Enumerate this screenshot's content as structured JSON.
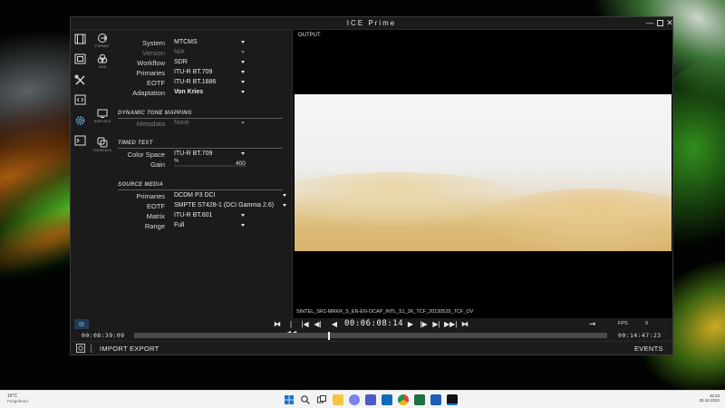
{
  "window": {
    "title": "ICE Prime",
    "minimize_glyph": "—",
    "close_glyph": "✕"
  },
  "sidebar": {
    "rail_icons": [
      "film-icon",
      "film-grid-icon",
      "tools-icon",
      "code-window-icon",
      "gear-icon",
      "terminal-icon"
    ],
    "sub_items": [
      {
        "label": "FORMAT",
        "icon": "format-exit-icon"
      },
      {
        "label": "CMS",
        "icon": "color-circles-icon"
      },
      {
        "label": "DISPLAYS",
        "icon": "display-icon"
      },
      {
        "label": "OVERLAYS",
        "icon": "overlays-icon"
      }
    ]
  },
  "settings": {
    "system": {
      "label": "System",
      "value": "MTCMS"
    },
    "version": {
      "label": "Version",
      "value": "N/A"
    },
    "workflow": {
      "label": "Workflow",
      "value": "SDR"
    },
    "primaries": {
      "label": "Primaries",
      "value": "ITU-R BT.709"
    },
    "eotf": {
      "label": "EOTF",
      "value": "ITU-R BT.1886"
    },
    "adaptation": {
      "label": "Adaptation",
      "value": "Von Kries"
    },
    "dtm_section": "DYNAMIC TONE MAPPING",
    "metadata": {
      "label": "Metadata",
      "value": "None"
    },
    "timed_text_section": "TIMED TEXT",
    "color_space": {
      "label": "Color Space",
      "value": "ITU-R BT.709"
    },
    "gain": {
      "label": "Gain",
      "percent_label": "%",
      "value": "400",
      "level": 0.0
    },
    "source_section": "SOURCE MEDIA",
    "src_primaries": {
      "label": "Primaries",
      "value": "DCDM P3 DCI"
    },
    "src_eotf": {
      "label": "EOTF",
      "value": "SMPTE ST428-1 (DCI Gamma 2.6)"
    },
    "matrix": {
      "label": "Matrix",
      "value": "ITU-R BT.601"
    },
    "range": {
      "label": "Range",
      "value": "Full"
    }
  },
  "viewer": {
    "label": "OUTPUT",
    "filename": "SINTEL_SR1-MRKR_S_EN-EN-OCAP_INTL_51_2K_TCF_20130529_TCF_OV"
  },
  "transport": {
    "timecode": "00:06:08:14",
    "fps_label": "FPS",
    "fps_value": "0",
    "buttons": [
      "⧓",
      "|◀◀",
      "|◀",
      "◀|",
      "◀",
      "▶",
      "|▶",
      "▶|",
      "▶▶|",
      "⧓"
    ],
    "forward_arrow": "➞"
  },
  "timeline": {
    "start": "00:08:39:09",
    "end": "00:14:47:23",
    "position": 0.41
  },
  "bottombar": {
    "import": "IMPORT",
    "export": "EXPORT",
    "events": "EVENTS"
  },
  "taskbar": {
    "temperature": "16°C",
    "condition": "Freigehend",
    "time": "15:23",
    "date": "25.10.2022",
    "icons": [
      "windows-start-icon",
      "search-icon",
      "task-view-icon",
      "file-explorer-icon",
      "chat-icon",
      "teams-icon",
      "outlook-icon",
      "chrome-icon",
      "excel-icon",
      "word-icon",
      "ice-prime-icon"
    ]
  },
  "colors": {
    "window_bg": "#1b1b1b",
    "accent_blue": "#6fa6d8",
    "text": "#e8e8e8"
  }
}
